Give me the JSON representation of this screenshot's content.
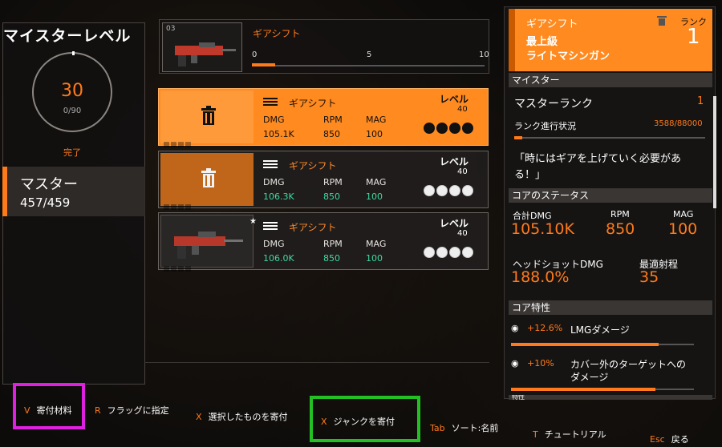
{
  "mastery_panel": {
    "title": "マイスターレベル",
    "ring_value": "30",
    "ring_sub": "0/90",
    "ring_status": "完了",
    "master_label": "マスター",
    "master_count": "457/459"
  },
  "top_item": {
    "slot": "03",
    "name": "ギアシフト",
    "scale_labels": [
      "0",
      "5",
      "10"
    ],
    "progress_fraction": 0.1
  },
  "cards": [
    {
      "name": "ギアシフト",
      "level_label": "レベル",
      "level": "40",
      "stats": [
        {
          "label": "DMG",
          "value": "105.1K"
        },
        {
          "label": "RPM",
          "value": "850"
        },
        {
          "label": "MAG",
          "value": "100"
        }
      ]
    },
    {
      "name": "ギアシフト",
      "level_label": "レベル",
      "level": "40",
      "stats": [
        {
          "label": "DMG",
          "value": "106.3K"
        },
        {
          "label": "RPM",
          "value": "850"
        },
        {
          "label": "MAG",
          "value": "100"
        }
      ]
    },
    {
      "name": "ギアシフト",
      "level_label": "レベル",
      "level": "40",
      "stats": [
        {
          "label": "DMG",
          "value": "106.0K"
        },
        {
          "label": "RPM",
          "value": "850"
        },
        {
          "label": "MAG",
          "value": "100"
        }
      ]
    }
  ],
  "detail": {
    "name": "ギアシフト",
    "rarity": "最上級",
    "type": "ライトマシンガン",
    "rank_label": "ランク",
    "rank_value": "1",
    "section_master": "マイスター",
    "master_rank_label": "マスターランク",
    "master_rank_value": "1",
    "rank_progress_label": "ランク進行状況",
    "rank_progress_value": "3588/88000",
    "quote": "「時にはギアを上げていく必要がある！」",
    "section_core_stats": "コアのステータス",
    "total_dmg_label": "合計DMG",
    "total_dmg": "105.10K",
    "rpm_label": "RPM",
    "rpm": "850",
    "mag_label": "MAG",
    "mag": "100",
    "hs_label": "ヘッドショットDMG",
    "hs": "188.0%",
    "range_label": "最適射程",
    "range": "35",
    "section_core_attr": "コア特性",
    "attr1_value": "+12.6%",
    "attr1_label": "LMGダメージ",
    "attr2_value": "+10%",
    "attr2_label": "カバー外のターゲットへのダメージ",
    "section_attr_cut": "特性"
  },
  "actions": [
    {
      "key": "V",
      "label": "寄付材料"
    },
    {
      "key": "R",
      "label": "フラッグに指定"
    },
    {
      "key": "X",
      "label": "選択したものを寄付"
    },
    {
      "key": "X",
      "label": "ジャンクを寄付"
    },
    {
      "key": "Tab",
      "label": "ソート:名前"
    },
    {
      "key": "T",
      "label": "チュートリアル"
    },
    {
      "key": "Esc",
      "label": "戻る"
    }
  ],
  "colors": {
    "accent": "#ff7a1a",
    "stat_up": "#3fd9a0",
    "highlight_magenta": "#e020e0",
    "highlight_green": "#22c022"
  }
}
